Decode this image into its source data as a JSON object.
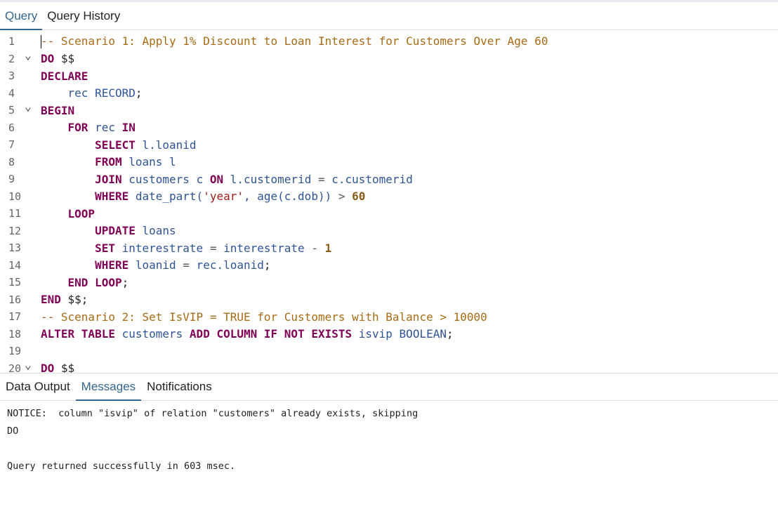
{
  "top_tabs": [
    {
      "label": "Query",
      "active": true
    },
    {
      "label": "Query History",
      "active": false
    }
  ],
  "editor": {
    "lines": [
      {
        "n": "1",
        "fold": false,
        "tokens": [
          [
            "cm",
            "-- Scenario 1: Apply 1% Discount to Loan Interest for Customers Over Age 60"
          ]
        ]
      },
      {
        "n": "2",
        "fold": true,
        "tokens": [
          [
            "kw",
            "DO "
          ],
          [
            "plain",
            "$$"
          ]
        ]
      },
      {
        "n": "3",
        "fold": false,
        "tokens": [
          [
            "kw",
            "DECLARE"
          ]
        ]
      },
      {
        "n": "4",
        "fold": false,
        "tokens": [
          [
            "plain",
            "    "
          ],
          [
            "id",
            "rec "
          ],
          [
            "id",
            "RECORD"
          ],
          [
            "plain",
            ";"
          ]
        ]
      },
      {
        "n": "5",
        "fold": true,
        "tokens": [
          [
            "kw",
            "BEGIN"
          ]
        ]
      },
      {
        "n": "6",
        "fold": false,
        "tokens": [
          [
            "plain",
            "    "
          ],
          [
            "kw",
            "FOR "
          ],
          [
            "id",
            "rec "
          ],
          [
            "kw",
            "IN"
          ]
        ]
      },
      {
        "n": "7",
        "fold": false,
        "tokens": [
          [
            "plain",
            "        "
          ],
          [
            "kw",
            "SELECT "
          ],
          [
            "id",
            "l.loanid"
          ]
        ]
      },
      {
        "n": "8",
        "fold": false,
        "tokens": [
          [
            "plain",
            "        "
          ],
          [
            "kw",
            "FROM "
          ],
          [
            "id",
            "loans l"
          ]
        ]
      },
      {
        "n": "9",
        "fold": false,
        "tokens": [
          [
            "plain",
            "        "
          ],
          [
            "kw",
            "JOIN "
          ],
          [
            "id",
            "customers c "
          ],
          [
            "kw",
            "ON "
          ],
          [
            "id",
            "l.customerid "
          ],
          [
            "op",
            "= "
          ],
          [
            "id",
            "c.customerid"
          ]
        ]
      },
      {
        "n": "10",
        "fold": false,
        "tokens": [
          [
            "plain",
            "        "
          ],
          [
            "kw",
            "WHERE "
          ],
          [
            "id",
            "date_part("
          ],
          [
            "str",
            "'year'"
          ],
          [
            "id",
            ", age(c.dob)) "
          ],
          [
            "op",
            "> "
          ],
          [
            "num",
            "60"
          ]
        ]
      },
      {
        "n": "11",
        "fold": false,
        "tokens": [
          [
            "plain",
            "    "
          ],
          [
            "kw",
            "LOOP"
          ]
        ]
      },
      {
        "n": "12",
        "fold": false,
        "tokens": [
          [
            "plain",
            "        "
          ],
          [
            "kw",
            "UPDATE "
          ],
          [
            "id",
            "loans"
          ]
        ]
      },
      {
        "n": "13",
        "fold": false,
        "tokens": [
          [
            "plain",
            "        "
          ],
          [
            "kw",
            "SET "
          ],
          [
            "id",
            "interestrate "
          ],
          [
            "op",
            "= "
          ],
          [
            "id",
            "interestrate "
          ],
          [
            "op",
            "- "
          ],
          [
            "num",
            "1"
          ]
        ]
      },
      {
        "n": "14",
        "fold": false,
        "tokens": [
          [
            "plain",
            "        "
          ],
          [
            "kw",
            "WHERE "
          ],
          [
            "id",
            "loanid "
          ],
          [
            "op",
            "= "
          ],
          [
            "id",
            "rec.loanid"
          ],
          [
            "plain",
            ";"
          ]
        ]
      },
      {
        "n": "15",
        "fold": false,
        "tokens": [
          [
            "plain",
            "    "
          ],
          [
            "kw",
            "END LOOP"
          ],
          [
            "plain",
            ";"
          ]
        ]
      },
      {
        "n": "16",
        "fold": false,
        "tokens": [
          [
            "kw",
            "END "
          ],
          [
            "plain",
            "$$;"
          ]
        ]
      },
      {
        "n": "17",
        "fold": false,
        "tokens": [
          [
            "cm",
            "-- Scenario 2: Set IsVIP = TRUE for Customers with Balance > 10000"
          ]
        ]
      },
      {
        "n": "18",
        "fold": false,
        "tokens": [
          [
            "kw",
            "ALTER TABLE "
          ],
          [
            "id",
            "customers "
          ],
          [
            "kw",
            "ADD COLUMN IF NOT EXISTS "
          ],
          [
            "id",
            "isvip BOOLEAN"
          ],
          [
            "plain",
            ";"
          ]
        ]
      },
      {
        "n": "19",
        "fold": false,
        "tokens": []
      },
      {
        "n": "20",
        "fold": true,
        "tokens": [
          [
            "kw",
            "DO "
          ],
          [
            "plain",
            "$$"
          ]
        ]
      }
    ]
  },
  "bottom_tabs": [
    {
      "label": "Data Output",
      "active": false
    },
    {
      "label": "Messages",
      "active": true
    },
    {
      "label": "Notifications",
      "active": false
    }
  ],
  "messages": {
    "notice": "NOTICE:  column \"isvip\" of relation \"customers\" already exists, skipping",
    "do": "DO",
    "result": "Query returned successfully in 603 msec."
  }
}
